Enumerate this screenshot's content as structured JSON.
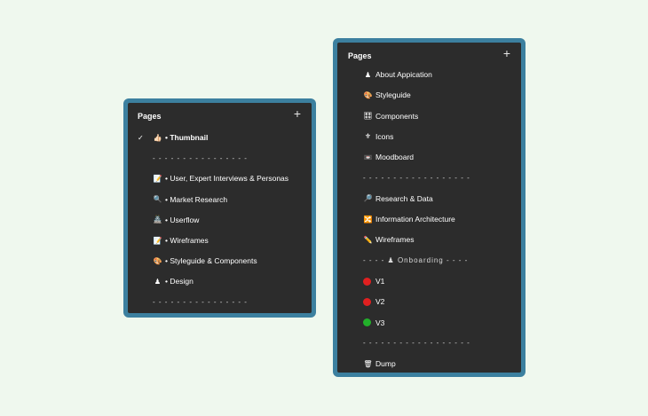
{
  "left_panel": {
    "title": "Pages",
    "add_icon": "+",
    "items": [
      {
        "kind": "page",
        "emoji": "👍🏻",
        "label": "• Thumbnail",
        "selected": true
      },
      {
        "kind": "separator",
        "label": "- - - - - - - - - - - - - - - -"
      },
      {
        "kind": "page",
        "emoji": "📝",
        "label": "• User, Expert Interviews & Personas"
      },
      {
        "kind": "page",
        "emoji": "🔍",
        "label": "• Market Research"
      },
      {
        "kind": "page",
        "emoji": "🏯",
        "label": "• Userflow"
      },
      {
        "kind": "page",
        "emoji": "📝",
        "label": "• Wireframes"
      },
      {
        "kind": "page",
        "emoji": "🎨",
        "label": "• Styleguide & Components"
      },
      {
        "kind": "page",
        "emoji": "♟",
        "label": "• Design"
      },
      {
        "kind": "separator",
        "label": "- - - - - - - - - - - - - - - -"
      }
    ]
  },
  "right_panel": {
    "title": "Pages",
    "add_icon": "+",
    "items": [
      {
        "kind": "page",
        "emoji": "♟",
        "label": "About Appication"
      },
      {
        "kind": "page",
        "emoji": "🎨",
        "label": "Styleguide"
      },
      {
        "kind": "page",
        "emoji": "🎛",
        "label": "Components"
      },
      {
        "kind": "page",
        "emoji": "⚜",
        "label": "Icons"
      },
      {
        "kind": "page",
        "emoji": "📼",
        "label": "Moodboard"
      },
      {
        "kind": "separator",
        "label": "- - - - - - - - - - - - - - - - - -"
      },
      {
        "kind": "page",
        "emoji": "🔎",
        "label": "Research & Data"
      },
      {
        "kind": "page",
        "emoji": "🔀",
        "label": "Information Architecture"
      },
      {
        "kind": "page",
        "emoji": "✏️",
        "label": "Wireframes"
      },
      {
        "kind": "section",
        "label": "- - - - ♟ Onboarding - - - -"
      },
      {
        "kind": "page",
        "dot": "#e02020",
        "label": "V1"
      },
      {
        "kind": "page",
        "dot": "#e02020",
        "label": "V2"
      },
      {
        "kind": "page",
        "dot": "#22b02a",
        "label": "V3"
      },
      {
        "kind": "separator",
        "label": "- - - - - - - - - - - - - - - - - -"
      },
      {
        "kind": "page",
        "emoji": "🗑",
        "label": "Dump"
      }
    ]
  }
}
